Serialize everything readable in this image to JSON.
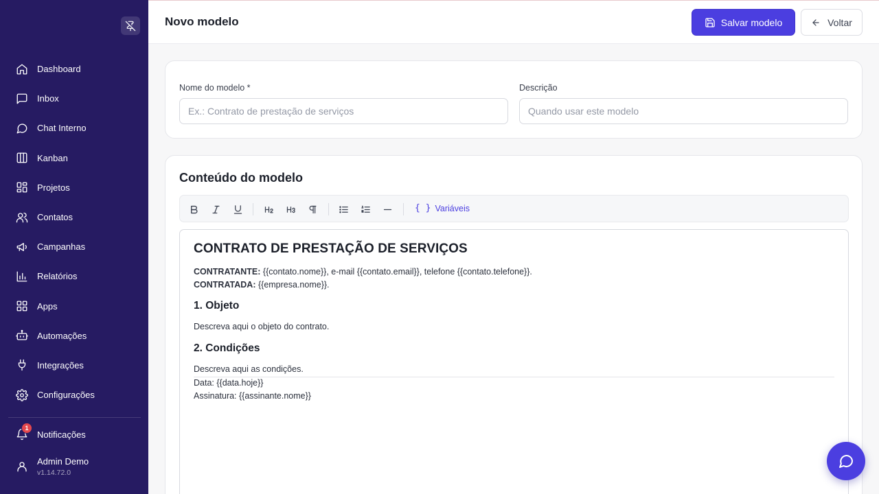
{
  "sidebar": {
    "items": [
      {
        "label": "Dashboard",
        "icon": "home-icon"
      },
      {
        "label": "Inbox",
        "icon": "inbox-icon"
      },
      {
        "label": "Chat Interno",
        "icon": "chat-icon"
      },
      {
        "label": "Kanban",
        "icon": "kanban-icon"
      },
      {
        "label": "Projetos",
        "icon": "projects-icon"
      },
      {
        "label": "Contatos",
        "icon": "contacts-icon"
      },
      {
        "label": "Campanhas",
        "icon": "megaphone-icon"
      },
      {
        "label": "Relatórios",
        "icon": "chart-icon"
      },
      {
        "label": "Apps",
        "icon": "apps-icon"
      },
      {
        "label": "Automações",
        "icon": "bot-icon"
      },
      {
        "label": "Integrações",
        "icon": "plug-icon"
      },
      {
        "label": "Configurações",
        "icon": "gear-icon"
      }
    ],
    "notifications": {
      "label": "Notificações",
      "count": "1"
    },
    "user": {
      "name": "Admin Demo",
      "version": "v1.14.72.0"
    }
  },
  "header": {
    "title": "Novo modelo",
    "save_label": "Salvar modelo",
    "back_label": "Voltar"
  },
  "form": {
    "name_label": "Nome do modelo *",
    "name_placeholder": "Ex.: Contrato de prestação de serviços",
    "desc_label": "Descrição",
    "desc_placeholder": "Quando usar este modelo"
  },
  "content": {
    "title": "Conteúdo do modelo",
    "variables_label": "Variáveis",
    "variables_braces": "{ }"
  },
  "document": {
    "title": "CONTRATO DE PRESTAÇÃO DE SERVIÇOS",
    "contratante_label": "CONTRATANTE:",
    "contratante_text": " {{contato.nome}}, e-mail {{contato.email}}, telefone {{contato.telefone}}.",
    "contratada_label": "CONTRATADA:",
    "contratada_text": " {{empresa.nome}}.",
    "h1": "1. Objeto",
    "p1": "Descreva aqui o objeto do contrato.",
    "h2": "2. Condições",
    "p2": "Descreva aqui as condições.",
    "data_line": "Data: {{data.hoje}}",
    "sign_line": "Assinatura: {{assinante.nome}}"
  },
  "colors": {
    "sidebar_bg": "#261b62",
    "accent": "#4b3ee0",
    "badge": "#e5484d"
  }
}
